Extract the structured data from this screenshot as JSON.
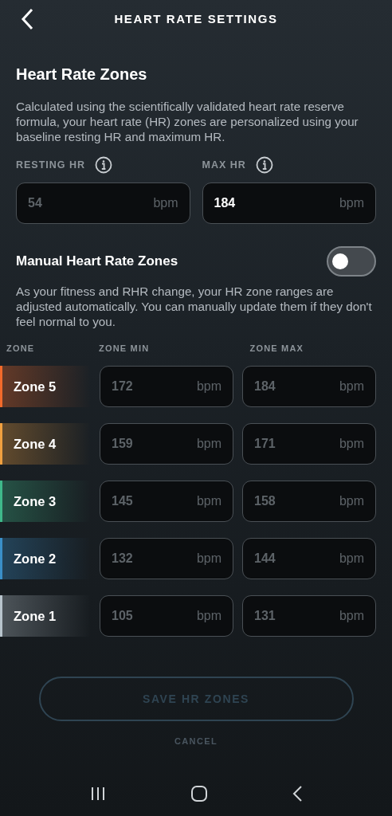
{
  "header": {
    "title": "HEART RATE SETTINGS"
  },
  "zones_section": {
    "title": "Heart Rate Zones",
    "description": "Calculated using the scientifically validated heart rate reserve formula, your heart rate (HR) zones are personalized using your baseline resting HR and maximum HR."
  },
  "hr_fields": [
    {
      "label": "RESTING HR",
      "placeholder": "54",
      "unit": "bpm"
    },
    {
      "label": "MAX HR",
      "value": "184",
      "unit": "bpm"
    }
  ],
  "manual": {
    "title": "Manual Heart Rate Zones",
    "on": false,
    "description": "As your fitness and RHR change, your HR zone ranges are adjusted automatically. You can manually update them if they don't feel normal to you."
  },
  "zone_table": {
    "columns": [
      "ZONE",
      "ZONE MIN",
      "ZONE MAX"
    ],
    "rows": [
      {
        "zone": "Zone 5",
        "color": "#f26a2b",
        "min": "172",
        "min_unit": "bpm",
        "max": "184",
        "max_unit": "bpm",
        "disabled": true
      },
      {
        "zone": "Zone 4",
        "color": "#f0a040",
        "min": "159",
        "min_unit": "bpm",
        "max": "171",
        "max_unit": "bpm",
        "disabled": true
      },
      {
        "zone": "Zone 3",
        "color": "#3fb98a",
        "min": "145",
        "min_unit": "bpm",
        "max": "158",
        "max_unit": "bpm",
        "disabled": true
      },
      {
        "zone": "Zone 2",
        "color": "#3a8fc8",
        "min": "132",
        "min_unit": "bpm",
        "max": "144",
        "max_unit": "bpm",
        "disabled": true
      },
      {
        "zone": "Zone 1",
        "color": "#b8c4cc",
        "min": "105",
        "min_unit": "bpm",
        "max": "131",
        "max_unit": "bpm",
        "disabled": true
      }
    ]
  },
  "save_button": {
    "label": "SAVE HR ZONES",
    "disabled": true
  },
  "cancel_button": {
    "label": "CANCEL",
    "disabled": true
  }
}
